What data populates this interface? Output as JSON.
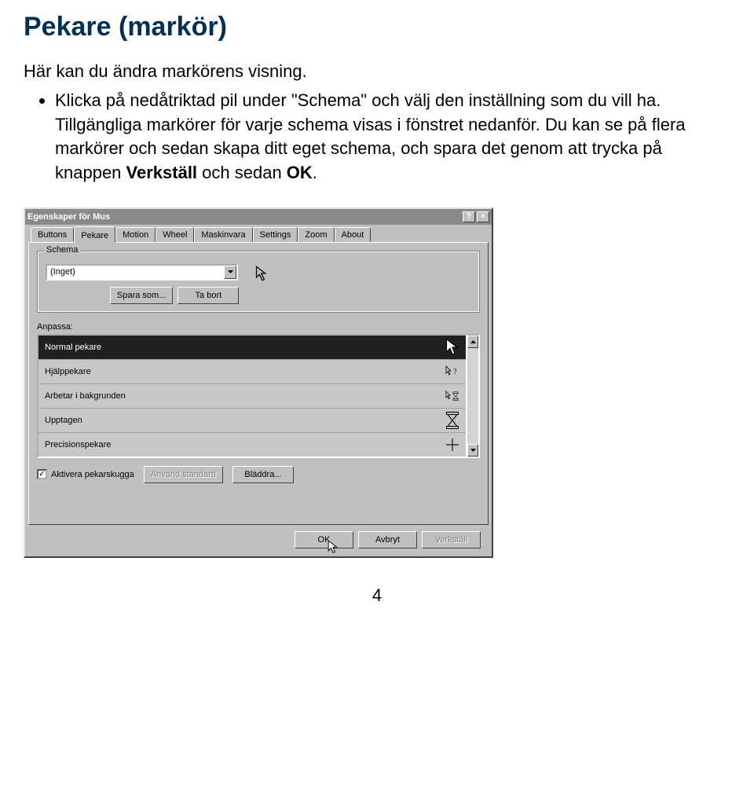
{
  "doc": {
    "title": "Pekare (markör)",
    "intro": "Här kan du ändra markörens visning.",
    "bullet": "Klicka på nedåtriktad pil under \"Schema\" och välj den inställning som du vill ha. Tillgängliga markörer för varje schema visas i fönstret nedanför. Du kan se på flera markörer och sedan skapa ditt eget schema, och spara det genom att trycka på knappen ",
    "bullet_bold1": "Verkställ",
    "bullet_mid": " och sedan ",
    "bullet_bold2": "OK",
    "bullet_end": ".",
    "page": "4"
  },
  "dialog": {
    "title": "Egenskaper för Mus",
    "help": "?",
    "close": "×",
    "tabs": [
      "Buttons",
      "Pekare",
      "Motion",
      "Wheel",
      "Maskinvara",
      "Settings",
      "Zoom",
      "About"
    ],
    "active_tab": 1,
    "schema": {
      "legend": "Schema",
      "value": "(Inget)",
      "save": "Spara som...",
      "delete": "Ta bort"
    },
    "anpassa_label": "Anpassa:",
    "list": [
      {
        "label": "Normal pekare",
        "icon": "arrow-white"
      },
      {
        "label": "Hjälppekare",
        "icon": "arrow-help"
      },
      {
        "label": "Arbetar i bakgrunden",
        "icon": "arrow-hourglass"
      },
      {
        "label": "Upptagen",
        "icon": "hourglass"
      },
      {
        "label": "Precisionspekare",
        "icon": "crosshair"
      }
    ],
    "shadow_checkbox": "Aktivera pekarskugga",
    "use_default": "Använd standard",
    "browse": "Bläddra...",
    "ok": "OK",
    "cancel": "Avbryt",
    "apply": "Verkställ"
  }
}
